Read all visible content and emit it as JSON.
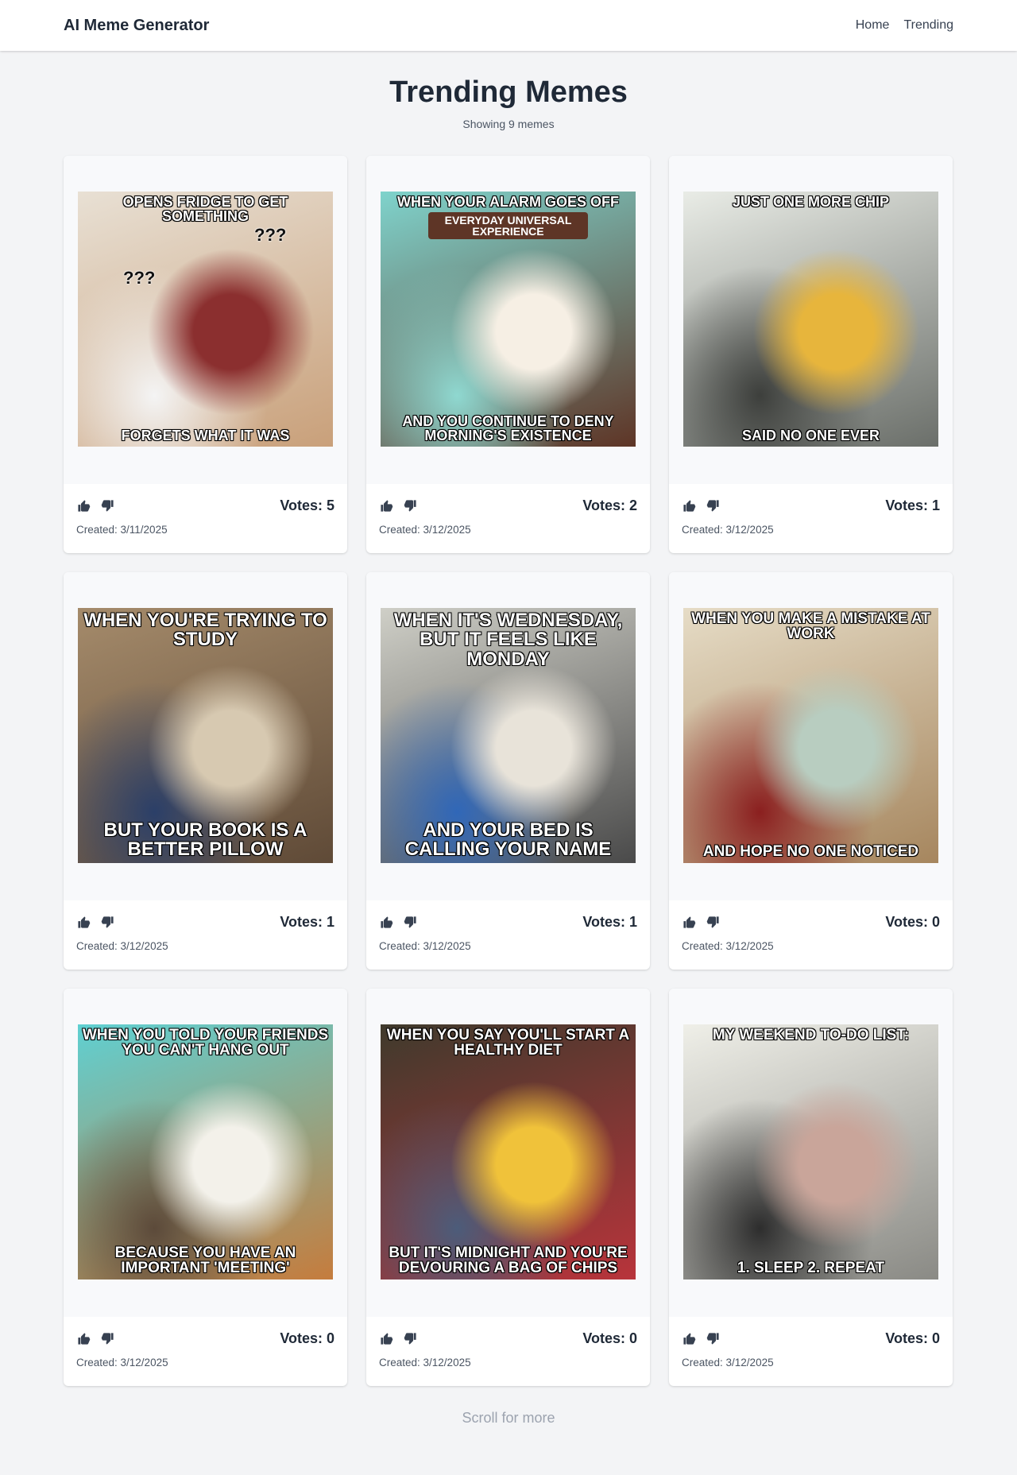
{
  "nav": {
    "brand": "AI Meme Generator",
    "links": [
      "Home",
      "Trending"
    ]
  },
  "header": {
    "title": "Trending Memes",
    "subtitle": "Showing 9 memes"
  },
  "memes": [
    {
      "top": "Opens fridge to get something",
      "bottom": "Forgets what it was",
      "top_size": "18px",
      "bottom_size": "18px",
      "palette": [
        "#e8e0d4",
        "#c9a07a",
        "#8b2f2f",
        "#f4f4f4"
      ],
      "votes": "Votes: 5",
      "created": "Created: 3/11/2025",
      "overlays": [
        "???",
        "???"
      ]
    },
    {
      "top": "When your alarm goes off",
      "bottom": "And you continue to deny morning's existence",
      "top_size": "18px",
      "bottom_size": "18px",
      "palette": [
        "#7fd3cc",
        "#5e3526",
        "#f6efe4",
        "#8fd8d0"
      ],
      "votes": "Votes: 2",
      "created": "Created: 3/12/2025",
      "overlays": [
        "EVERYDAY UNIVERSAL EXPERIENCE"
      ]
    },
    {
      "top": "Just one more chip",
      "bottom": "Said no one ever",
      "top_size": "18px",
      "bottom_size": "18px",
      "palette": [
        "#e9ece6",
        "#6b6f6a",
        "#e7b53c",
        "#3d3f3c"
      ],
      "votes": "Votes: 1",
      "created": "Created: 3/12/2025",
      "overlays": []
    },
    {
      "top": "When you're trying to study",
      "bottom": "But your book is a better pillow",
      "top_size": "24px",
      "bottom_size": "24px",
      "palette": [
        "#a58b6b",
        "#5f4a37",
        "#d7c9b1",
        "#2b3f68"
      ],
      "votes": "Votes: 1",
      "created": "Created: 3/12/2025",
      "overlays": []
    },
    {
      "top": "When it's Wednesday, but it feels like Monday",
      "bottom": "And your bed is calling your name",
      "top_size": "24px",
      "bottom_size": "24px",
      "palette": [
        "#cfcfc7",
        "#4a4a4a",
        "#e8e3d9",
        "#3067b8"
      ],
      "votes": "Votes: 1",
      "created": "Created: 3/12/2025",
      "overlays": []
    },
    {
      "top": "When you make a mistake at work",
      "bottom": "And hope no one noticed",
      "top_size": "19px",
      "bottom_size": "19px",
      "palette": [
        "#e6dcc6",
        "#a6865e",
        "#b8cdc0",
        "#8b1f1f"
      ],
      "votes": "Votes: 0",
      "created": "Created: 3/12/2025",
      "overlays": []
    },
    {
      "top": "When you told your friends you can't hang out",
      "bottom": "Because you have an important 'meeting'",
      "top_size": "19px",
      "bottom_size": "19px",
      "palette": [
        "#5fd0d2",
        "#c57c3d",
        "#f3f1ea",
        "#5c4a3a"
      ],
      "votes": "Votes: 0",
      "created": "Created: 3/12/2025",
      "overlays": []
    },
    {
      "top": "When you say you'll start a healthy diet",
      "bottom": "But it's midnight and you're devouring a bag of chips",
      "top_size": "19px",
      "bottom_size": "19px",
      "palette": [
        "#3f3a2c",
        "#b8343b",
        "#f0c23a",
        "#4c5c7a"
      ],
      "votes": "Votes: 0",
      "created": "Created: 3/12/2025",
      "overlays": []
    },
    {
      "top": "My weekend to-do list:",
      "bottom": "1. Sleep 2. Repeat",
      "top_size": "19px",
      "bottom_size": "19px",
      "palette": [
        "#efefe8",
        "#8a8a85",
        "#c9a59a",
        "#2d2d2d"
      ],
      "votes": "Votes: 0",
      "created": "Created: 3/12/2025",
      "overlays": []
    }
  ],
  "footer": {
    "scroll_text": "Scroll for more"
  }
}
